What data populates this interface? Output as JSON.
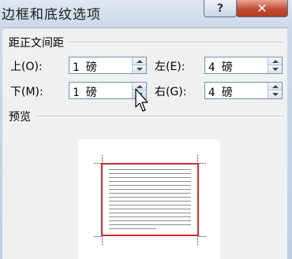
{
  "window": {
    "title": "边框和底纹选项",
    "help_label": "?",
    "close_label": "✕"
  },
  "margins": {
    "group_label": "距正文间距",
    "top": {
      "label": "上(O):",
      "value": "1 磅"
    },
    "bottom": {
      "label": "下(M):",
      "value": "1 磅"
    },
    "left": {
      "label": "左(E):",
      "value": "4 磅"
    },
    "right": {
      "label": "右(G):",
      "value": "4 磅"
    }
  },
  "preview": {
    "group_label": "预览"
  },
  "colors": {
    "border_color": "#d22b2b",
    "close_button": "#c44c34"
  },
  "icons": {
    "spin_up": "triangle-up-icon",
    "spin_down": "triangle-down-icon",
    "cursor": "arrow-pointer-icon"
  }
}
